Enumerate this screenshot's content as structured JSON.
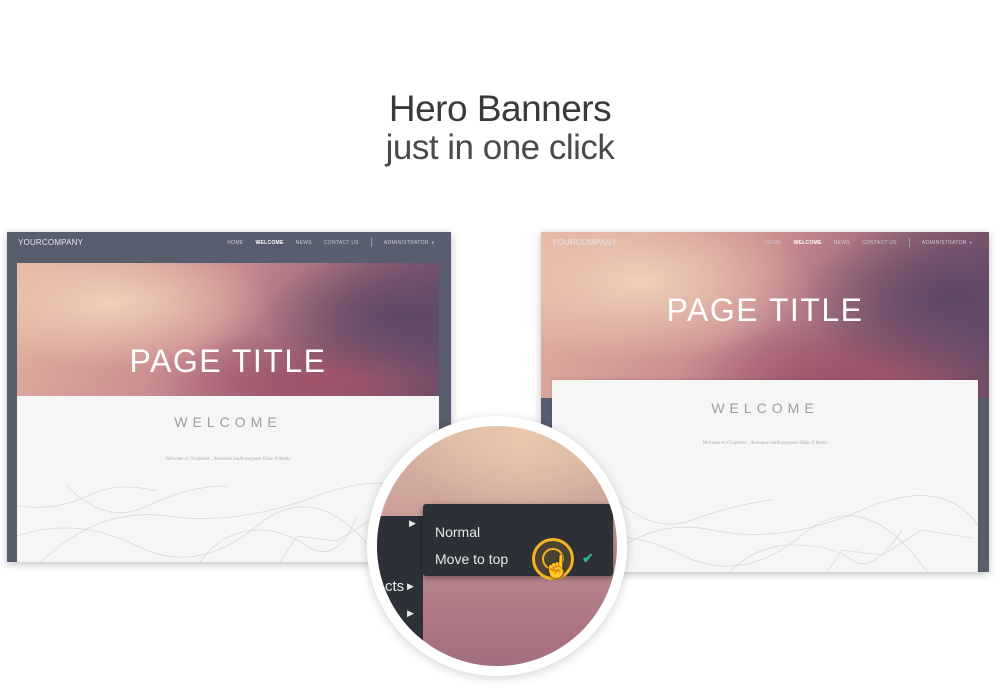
{
  "headline": {
    "title": "Hero Banners",
    "subtitle": "just in one click"
  },
  "left_screenshot": {
    "brand": "YOURCOMPANY",
    "nav": [
      "HOME",
      "WELCOME",
      "NEWS",
      "CONTACT US",
      "ADMINISTRATOR"
    ],
    "page_title": "PAGE TITLE",
    "welcome": "WELCOME",
    "tagline": "Welcome to Graphene , Awesome multi-porpose Odoo 8 theme"
  },
  "right_screenshot": {
    "brand": "YOURCOMPANY",
    "nav": [
      "HOME",
      "WELCOME",
      "NEWS",
      "CONTACT US",
      "ADMINISTRATOR"
    ],
    "page_title": "PAGE TITLE",
    "welcome": "WELCOME",
    "tagline": "Welcome to Graphene , Awesome multi-porpose Odoo 8 theme"
  },
  "magnifier": {
    "options": [
      "Normal",
      "Move to top"
    ],
    "selected": "Move to top",
    "partial_label": "cts"
  },
  "colors": {
    "accent_ring": "#f4b41f",
    "check": "#2fb386",
    "menu_bg": "#2d3037",
    "navbar": "#585e6d"
  }
}
